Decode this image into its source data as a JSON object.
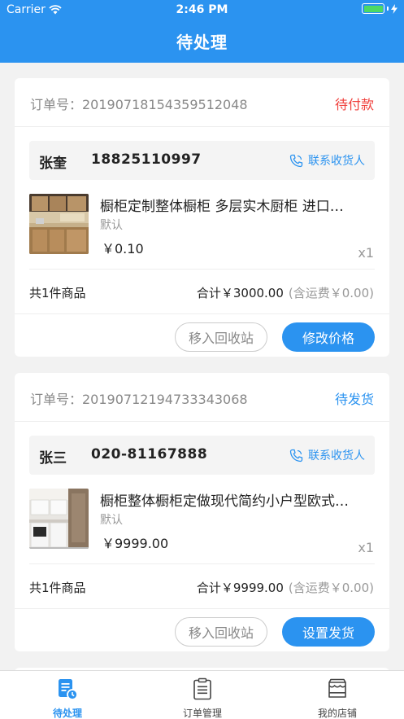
{
  "status_bar": {
    "carrier": "Carrier",
    "time": "2:46 PM"
  },
  "header": {
    "title": "待处理"
  },
  "orders": [
    {
      "order_no": "订单号：2019071815435951204​8",
      "status": "待付款",
      "status_color": "#f0403c",
      "contact_name": "张奎",
      "contact_phone": "18825110997",
      "contact_label": "联系收货人",
      "product_name": "橱柜定制整体橱柜 多层实木厨柜 进口…",
      "product_spec": "默认",
      "product_price": "￥0.10",
      "product_qty": "x1",
      "count": "共1件商品",
      "total": "合计￥3000.00",
      "shipping": "(含运费￥0.00)",
      "secondary_btn": "移入回收站",
      "primary_btn": "修改价格"
    },
    {
      "order_no": "订单号：20190712194733343068",
      "status": "待发货",
      "status_color": "#2b93f0",
      "contact_name": "张三",
      "contact_phone": "020-81167888",
      "contact_label": "联系收货人",
      "product_name": "橱柜整体橱柜定做现代简约小户型欧式…",
      "product_spec": "默认",
      "product_price": "￥9999.00",
      "product_qty": "x1",
      "count": "共1件商品",
      "total": "合计￥9999.00",
      "shipping": "(含运费￥0.00)",
      "secondary_btn": "移入回收站",
      "primary_btn": "设置发货"
    }
  ],
  "tabs": [
    {
      "label": "待处理",
      "icon": "pending-doc-icon",
      "active": true
    },
    {
      "label": "订单管理",
      "icon": "clipboard-icon",
      "active": false
    },
    {
      "label": "我的店铺",
      "icon": "store-icon",
      "active": false
    }
  ],
  "colors": {
    "accent": "#2b93f0",
    "alert": "#f0403c"
  }
}
